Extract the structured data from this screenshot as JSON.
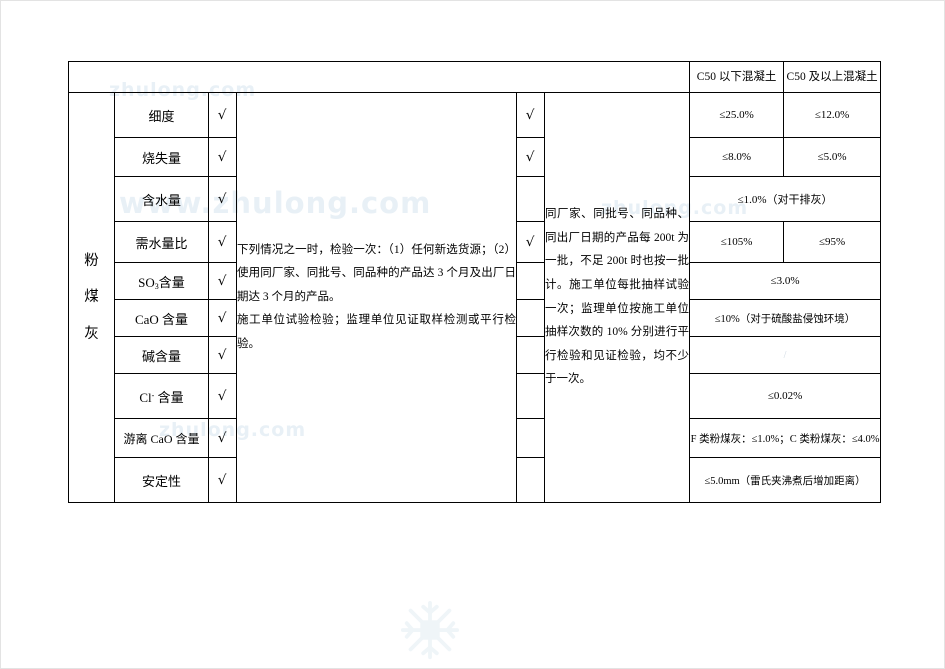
{
  "document": {
    "watermarks": [
      {
        "text": "zhulong.com",
        "id": "wm-a"
      },
      {
        "text": "www.zhulong.com",
        "id": "wm-b"
      },
      {
        "text": "zhulong.com",
        "id": "wm-c"
      },
      {
        "text": "zhulong.com",
        "id": "wm-d"
      }
    ],
    "snowflake_label": "snowflake-watermark"
  },
  "table": {
    "header": {
      "blank_label": "",
      "col_c50_below": "C50 以下混凝土",
      "col_c50_above": "C50 及以上混凝土"
    },
    "group": {
      "chars": [
        "粉",
        "煤",
        "灰"
      ],
      "label": "粉煤灰"
    },
    "check_mark": "√",
    "items": [
      {
        "name": "细度",
        "check1": "√"
      },
      {
        "name": "烧失量",
        "check1": "√"
      },
      {
        "name": "含水量",
        "check1": "√"
      },
      {
        "name": "需水量比",
        "check1": "√"
      },
      {
        "name": "SO",
        "sub": "3",
        "suffix": "含量",
        "check1": "√"
      },
      {
        "name": "CaO 含量",
        "check1": "√"
      },
      {
        "name": "碱含量",
        "check1": "√"
      },
      {
        "name": "Cl",
        "sup": "-",
        "suffix": " 含量",
        "check1": "√"
      },
      {
        "name": "游离 CaO 含量",
        "check1": "√"
      },
      {
        "name": "安定性",
        "check1": "√"
      }
    ],
    "checks2": {
      "row1": "√",
      "row2": "√",
      "row4": "√"
    },
    "description_left": {
      "p1": "下列情况之一时，检验一次：（1）任何新选货源；（2）使用同厂家、同批号、同品种的产品达 3 个月及出厂日期达 3 个月的产品。",
      "p2": "施工单位试验检验；监理单位见证取样检测或平行检验。"
    },
    "description_right": {
      "p1": "同厂家、同批号、同品种、同出厂日期的产品每 200t 为一批，不足 200t 时也按一批计。施工单位每批抽样试验一次；监理单位按施工单位抽样次数的 10% 分别进行平行检验和见证检验，均不少于一次。"
    },
    "values": {
      "fineness_below": "≤25.0%",
      "fineness_above": "≤12.0%",
      "loss_below": "≤8.0%",
      "loss_above": "≤5.0%",
      "moisture_span": "≤1.0%（对干排灰）",
      "water_demand_below": "≤105%",
      "water_demand_above": "≤95%",
      "so3_span": "≤3.0%",
      "cao_span": "≤10%（对于硫酸盐侵蚀环境）",
      "alkali_span": "/",
      "cl_span": "≤0.02%",
      "free_cao_span": "F 类粉煤灰：≤1.0%；C 类粉煤灰：≤4.0%",
      "stability_span": "≤5.0mm（雷氏夹沸煮后增加距离）"
    }
  }
}
